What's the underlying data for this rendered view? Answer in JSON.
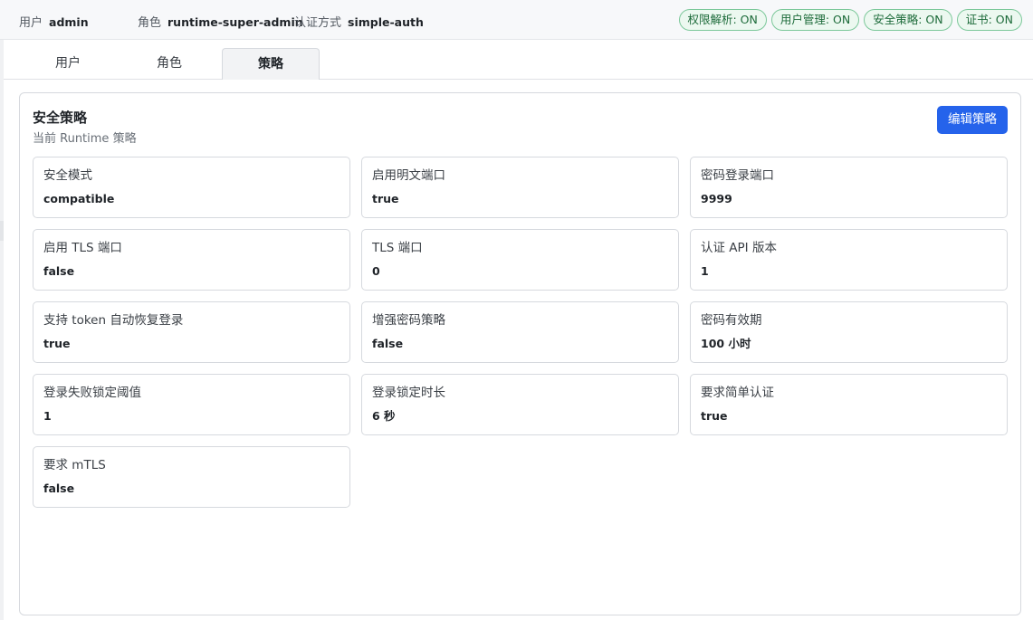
{
  "header": {
    "user": {
      "label": "用户",
      "value": "admin"
    },
    "role": {
      "label": "角色",
      "value": "runtime-super-admin"
    },
    "auth": {
      "label": "认证方式",
      "value": "simple-auth"
    },
    "badges": [
      "权限解析: ON",
      "用户管理: ON",
      "安全策略: ON",
      "证书: ON"
    ],
    "badge_color": "#1d6b3a"
  },
  "tabs": [
    {
      "label": "用户",
      "active": false
    },
    {
      "label": "角色",
      "active": false
    },
    {
      "label": "策略",
      "active": true
    }
  ],
  "panel": {
    "title": "安全策略",
    "subtitle": "当前 Runtime 策略",
    "edit_label": "编辑策略",
    "accent": "#2563eb",
    "items": [
      {
        "label": "安全模式",
        "value": "compatible"
      },
      {
        "label": "启用明文端口",
        "value": "true"
      },
      {
        "label": "密码登录端口",
        "value": "9999"
      },
      {
        "label": "启用 TLS 端口",
        "value": "false"
      },
      {
        "label": "TLS 端口",
        "value": "0"
      },
      {
        "label": "认证 API 版本",
        "value": "1"
      },
      {
        "label": "支持 token 自动恢复登录",
        "value": "true"
      },
      {
        "label": "增强密码策略",
        "value": "false"
      },
      {
        "label": "密码有效期",
        "value": "100 小时"
      },
      {
        "label": "登录失败锁定阈值",
        "value": "1"
      },
      {
        "label": "登录锁定时长",
        "value": "6 秒"
      },
      {
        "label": "要求简单认证",
        "value": "true"
      },
      {
        "label": "要求 mTLS",
        "value": "false"
      }
    ]
  }
}
